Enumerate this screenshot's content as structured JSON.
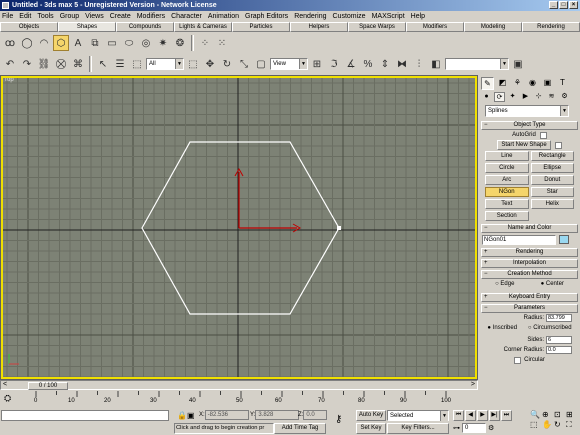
{
  "window": {
    "title": "Untitled - 3ds max 5 - Unregistered Version - Network License"
  },
  "menu": [
    "File",
    "Edit",
    "Tools",
    "Group",
    "Views",
    "Create",
    "Modifiers",
    "Character",
    "Animation",
    "Graph Editors",
    "Rendering",
    "Customize",
    "MAXScript",
    "Help"
  ],
  "tabs": [
    "Objects",
    "Shapes",
    "Compounds",
    "Lights & Cameras",
    "Particles",
    "Helpers",
    "Space Warps",
    "Modifiers",
    "Modeling",
    "Rendering"
  ],
  "active_tab": "Shapes",
  "toolbar": {
    "selection_filter": "All",
    "coord_system": "View"
  },
  "viewport": {
    "label": "Top"
  },
  "command_panel": {
    "category_dropdown": "Splines",
    "object_type": {
      "title": "Object Type",
      "autogrid_label": "AutoGrid",
      "start_new_shape_label": "Start New Shape",
      "buttons": [
        "Line",
        "Rectangle",
        "Circle",
        "Ellipse",
        "Arc",
        "Donut",
        "NGon",
        "Star",
        "Text",
        "Helix",
        "Section"
      ],
      "active_button": "NGon"
    },
    "name_and_color": {
      "title": "Name and Color",
      "name": "NGon01"
    },
    "rendering_title": "Rendering",
    "interpolation_title": "Interpolation",
    "creation_method": {
      "title": "Creation Method",
      "options": [
        "Edge",
        "Center"
      ],
      "selected": "Center"
    },
    "keyboard_entry_title": "Keyboard Entry",
    "parameters": {
      "title": "Parameters",
      "radius_label": "Radius:",
      "radius_value": "83.799",
      "inscribed_label": "Inscribed",
      "circumscribed_label": "Circumscribed",
      "inscribe_selected": "Inscribed",
      "sides_label": "Sides:",
      "sides_value": "6",
      "corner_radius_label": "Corner Radius:",
      "corner_radius_value": "0.0",
      "circular_label": "Circular"
    }
  },
  "timeline": {
    "slider_label": "0 / 100",
    "ticks": [
      "0",
      "10",
      "20",
      "30",
      "40",
      "50",
      "60",
      "70",
      "80",
      "90",
      "100"
    ]
  },
  "status": {
    "x_label": "X:",
    "x_value": "-82.536",
    "y_label": "Y:",
    "y_value": "3.828",
    "z_label": "Z:",
    "z_value": "0.0",
    "message": "Click and drag to begin creation pr",
    "add_time_tag": "Add Time Tag",
    "auto_key": "Auto Key",
    "set_key": "Set Key",
    "key_mode": "Selected",
    "key_filters": "Key Filters...",
    "frame": "0"
  }
}
